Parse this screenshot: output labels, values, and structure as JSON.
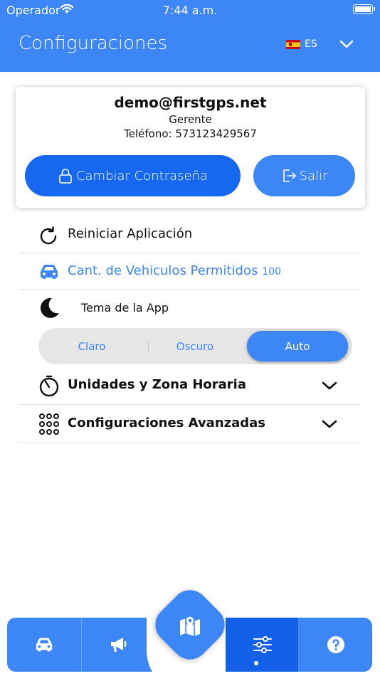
{
  "status": {
    "carrier": "Operador",
    "time": "7:44 a.m."
  },
  "header": {
    "title": "Configuraciones",
    "language": "ES"
  },
  "account": {
    "email": "demo@firstgps.net",
    "role": "Gerente",
    "phone_label": "Teléfono:",
    "phone": "573123429567",
    "change_password_label": "Cambiar Contraseña",
    "logout_label": "Salir"
  },
  "settings": {
    "restart_label": "Reiniciar Aplicación",
    "vehicles_label": "Cant. de Vehiculos Permitidos",
    "vehicles_count": "100",
    "theme_label": "Tema de la App",
    "theme_options": [
      "Claro",
      "Oscuro",
      "Auto"
    ],
    "theme_selected": "Auto",
    "units_label": "Unidades y Zona Horaria",
    "advanced_label": "Configuraciones Avanzadas"
  },
  "tabbar": {
    "items": [
      "car-icon",
      "megaphone-icon",
      "map-icon",
      "sliders-icon",
      "help-icon"
    ],
    "active": "sliders-icon"
  },
  "colors": {
    "primary": "#3d86f5",
    "primary_dark": "#1668f0",
    "text": "#111111"
  }
}
